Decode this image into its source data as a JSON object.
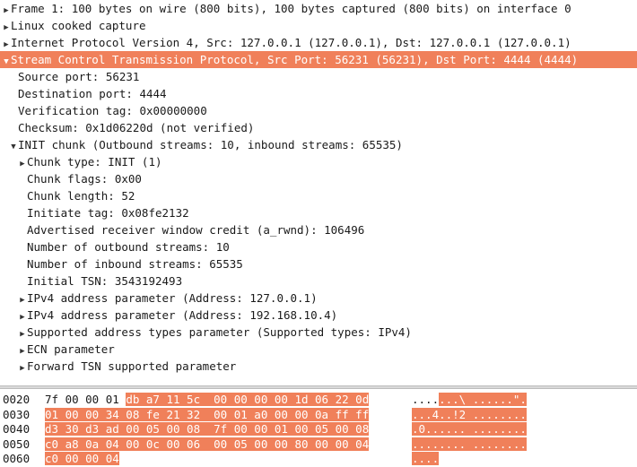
{
  "tree": {
    "rows": [
      {
        "indent": 0,
        "arrow": "right",
        "label": "Frame 1: 100 bytes on wire (800 bits), 100 bytes captured (800 bits) on interface 0"
      },
      {
        "indent": 0,
        "arrow": "right",
        "label": "Linux cooked capture"
      },
      {
        "indent": 0,
        "arrow": "right",
        "label": "Internet Protocol Version 4, Src: 127.0.0.1 (127.0.0.1), Dst: 127.0.0.1 (127.0.0.1)"
      },
      {
        "indent": 0,
        "arrow": "down",
        "selected": true,
        "label": "Stream Control Transmission Protocol, Src Port: 56231 (56231), Dst Port: 4444 (4444)"
      },
      {
        "indent": 1,
        "arrow": "none",
        "label": "Source port: 56231"
      },
      {
        "indent": 1,
        "arrow": "none",
        "label": "Destination port: 4444"
      },
      {
        "indent": 1,
        "arrow": "none",
        "label": "Verification tag: 0x00000000"
      },
      {
        "indent": 1,
        "arrow": "none",
        "label": "Checksum: 0x1d06220d (not verified)"
      },
      {
        "indent": 1,
        "arrow": "down",
        "label": "INIT chunk (Outbound streams: 10, inbound streams: 65535)"
      },
      {
        "indent": 2,
        "arrow": "right",
        "label": "Chunk type: INIT (1)"
      },
      {
        "indent": 2,
        "arrow": "none",
        "label": "Chunk flags: 0x00"
      },
      {
        "indent": 2,
        "arrow": "none",
        "label": "Chunk length: 52"
      },
      {
        "indent": 2,
        "arrow": "none",
        "label": "Initiate tag: 0x08fe2132"
      },
      {
        "indent": 2,
        "arrow": "none",
        "label": "Advertised receiver window credit (a_rwnd): 106496"
      },
      {
        "indent": 2,
        "arrow": "none",
        "label": "Number of outbound streams: 10"
      },
      {
        "indent": 2,
        "arrow": "none",
        "label": "Number of inbound streams: 65535"
      },
      {
        "indent": 2,
        "arrow": "none",
        "label": "Initial TSN: 3543192493"
      },
      {
        "indent": 2,
        "arrow": "right",
        "label": "IPv4 address parameter (Address: 127.0.0.1)"
      },
      {
        "indent": 2,
        "arrow": "right",
        "label": "IPv4 address parameter (Address: 192.168.10.4)"
      },
      {
        "indent": 2,
        "arrow": "right",
        "label": "Supported address types parameter (Supported types: IPv4)"
      },
      {
        "indent": 2,
        "arrow": "right",
        "label": "ECN parameter"
      },
      {
        "indent": 2,
        "arrow": "right",
        "label": "Forward TSN supported parameter"
      }
    ]
  },
  "hex": {
    "rows": [
      {
        "offset": "0020",
        "plain_bytes": "7f 00 00 01 ",
        "hl_bytes": "db a7 11 5c  00 00 00 00 1d 06 22 0d",
        "plain_ascii": "....",
        "hl_ascii": "...\\ ......\"."
      },
      {
        "offset": "0030",
        "plain_bytes": "",
        "hl_bytes": "01 00 00 34 08 fe 21 32  00 01 a0 00 00 0a ff ff",
        "plain_ascii": "",
        "hl_ascii": "...4..!2 ........"
      },
      {
        "offset": "0040",
        "plain_bytes": "",
        "hl_bytes": "d3 30 d3 ad 00 05 00 08  7f 00 00 01 00 05 00 08",
        "plain_ascii": "",
        "hl_ascii": ".0...... ........"
      },
      {
        "offset": "0050",
        "plain_bytes": "",
        "hl_bytes": "c0 a8 0a 04 00 0c 00 06  00 05 00 00 80 00 00 04",
        "plain_ascii": "",
        "hl_ascii": "........ ........"
      },
      {
        "offset": "0060",
        "plain_bytes": "",
        "hl_bytes": "c0 00 00 04",
        "plain_ascii": "",
        "hl_ascii": "...."
      }
    ]
  },
  "colors": {
    "selection": "#f0805a"
  }
}
